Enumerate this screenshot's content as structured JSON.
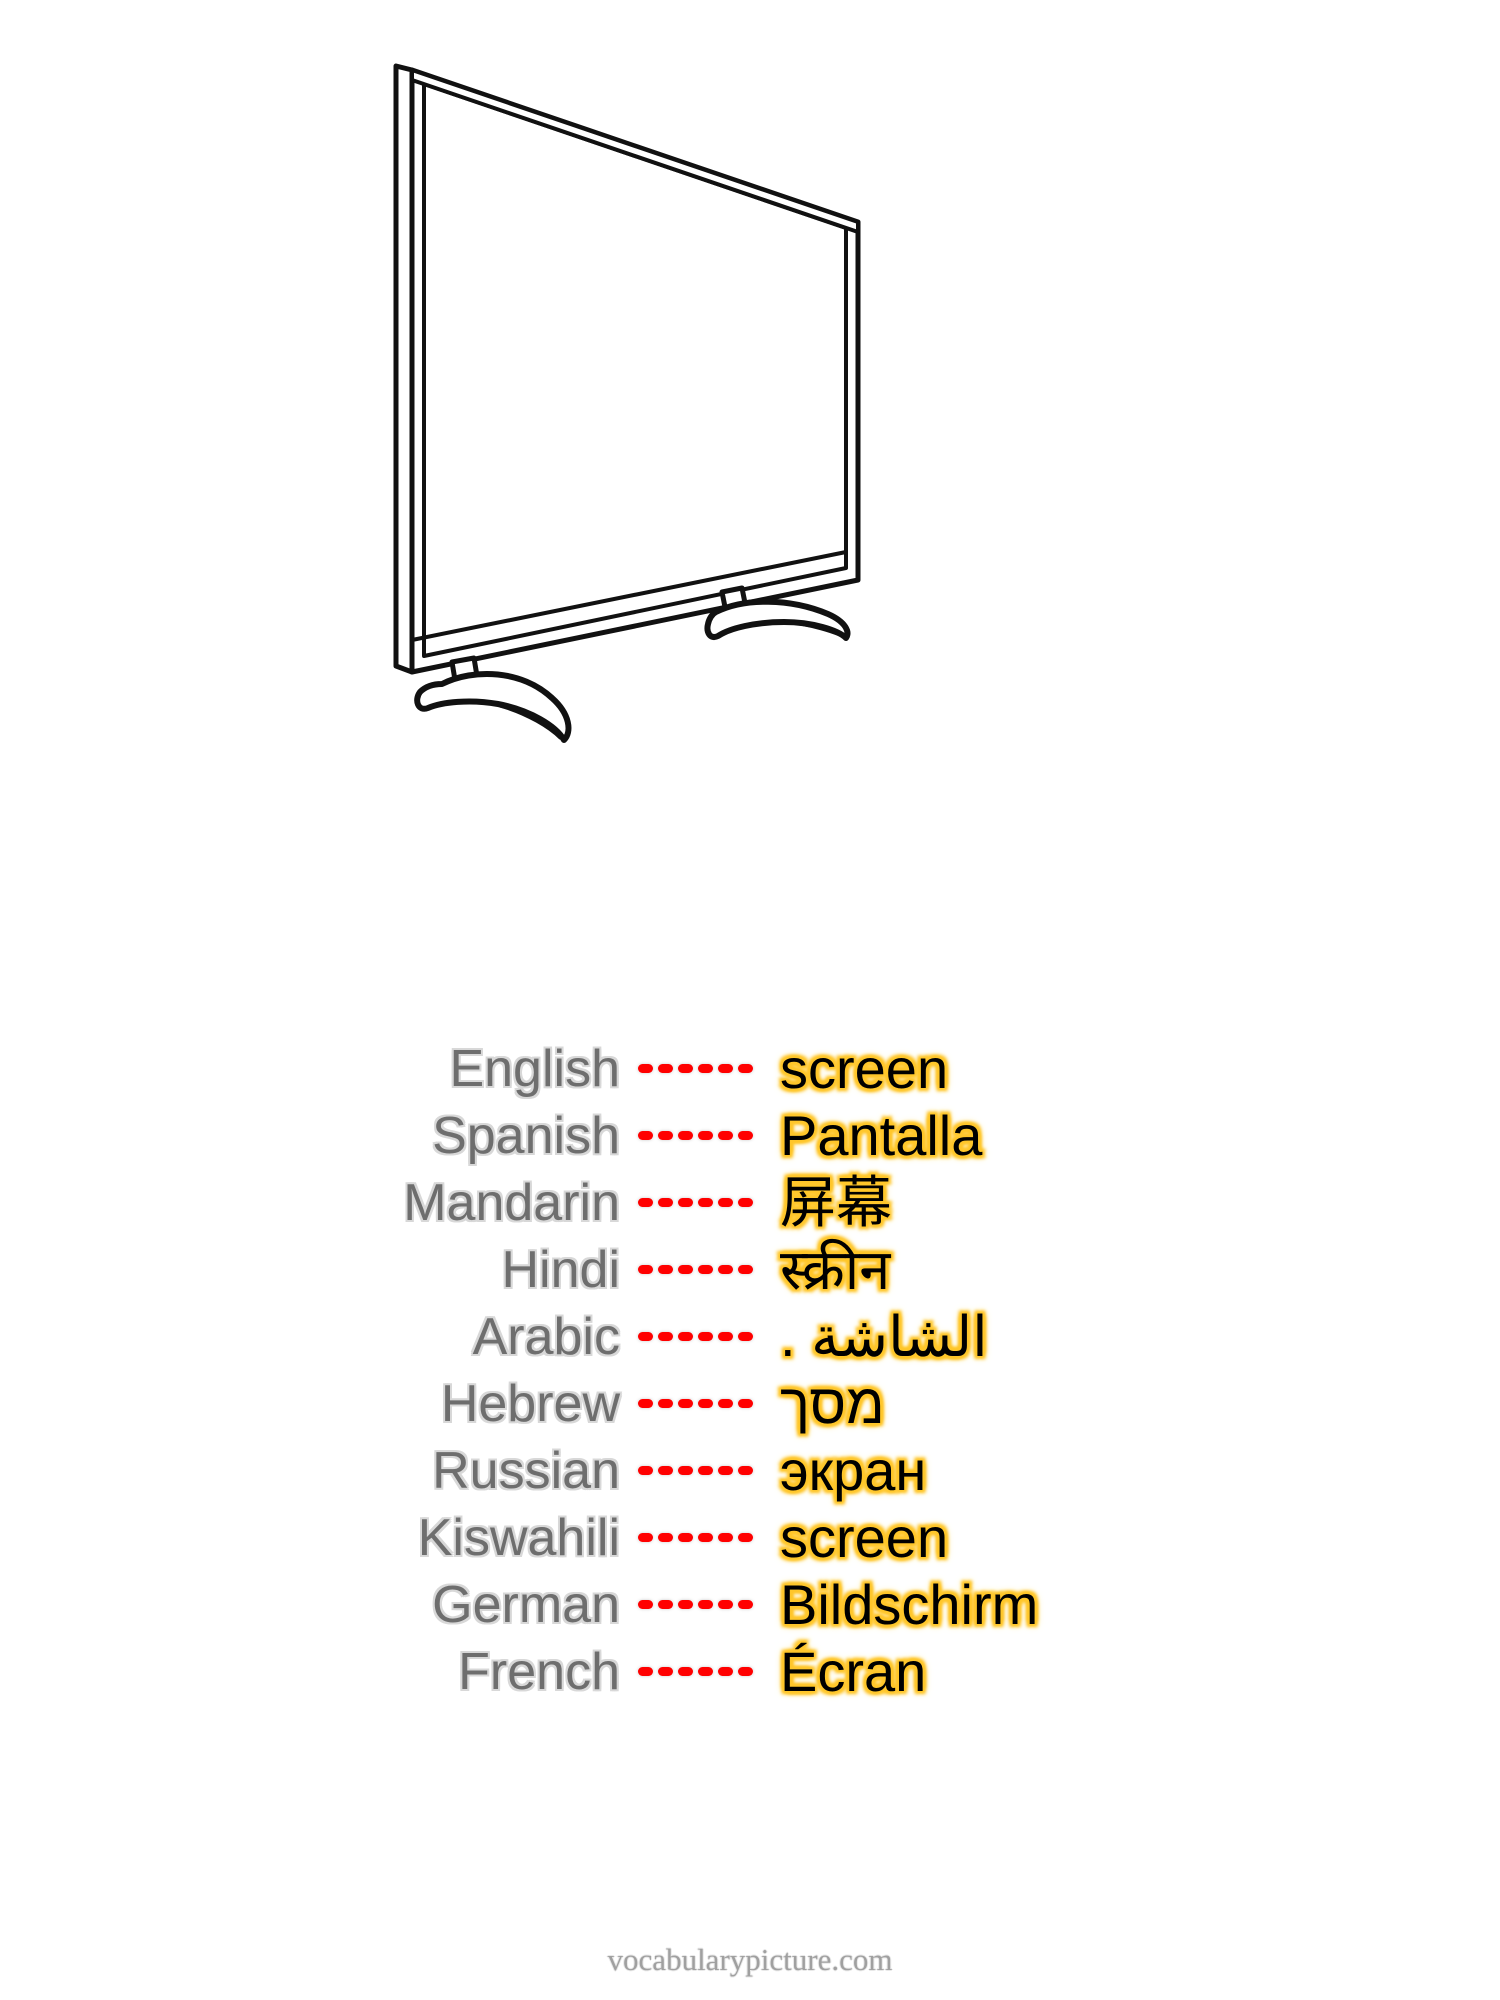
{
  "illustration": {
    "subject": "flat-screen-television",
    "alt": "line drawing of a flat screen TV on two curved stand feet",
    "stroke_color": "#000000",
    "fill_color": "#ffffff"
  },
  "vocabulary": {
    "separator": "------",
    "label_color": "#6e6e6e",
    "separator_color": "#ff0000",
    "translation_color": "#000000",
    "translation_glow_color": "#ffc72c",
    "rows": [
      {
        "language": "English",
        "translation": "screen",
        "rtl": false
      },
      {
        "language": "Spanish",
        "translation": "Pantalla",
        "rtl": false
      },
      {
        "language": "Mandarin",
        "translation": "屏幕",
        "rtl": false
      },
      {
        "language": "Hindi",
        "translation": "स्क्रीन",
        "rtl": false
      },
      {
        "language": "Arabic",
        "translation": "الشاشة .",
        "rtl": true
      },
      {
        "language": "Hebrew",
        "translation": "מסך",
        "rtl": true
      },
      {
        "language": "Russian",
        "translation": "экран",
        "rtl": false
      },
      {
        "language": "Kiswahili",
        "translation": "screen",
        "rtl": false
      },
      {
        "language": "German",
        "translation": "Bildschirm",
        "rtl": false
      },
      {
        "language": "French",
        "translation": "Écran",
        "rtl": false
      }
    ]
  },
  "footer": {
    "site": "vocabularypicture.com"
  }
}
